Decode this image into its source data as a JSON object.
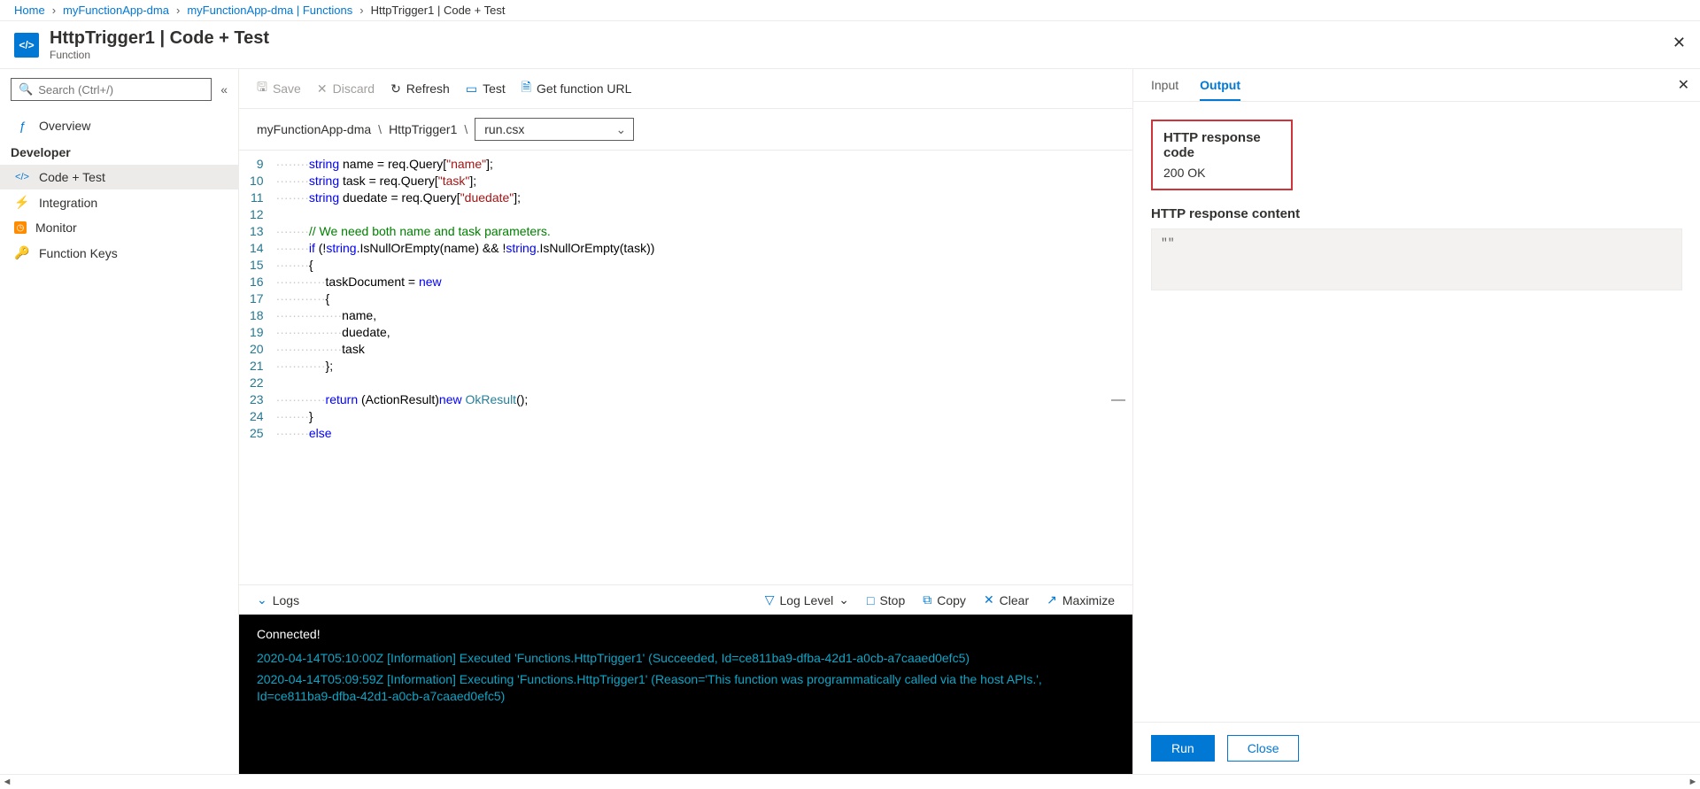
{
  "breadcrumb": [
    {
      "label": "Home",
      "link": true
    },
    {
      "label": "myFunctionApp-dma",
      "link": true
    },
    {
      "label": "myFunctionApp-dma | Functions",
      "link": true
    },
    {
      "label": "HttpTrigger1 | Code + Test",
      "link": false
    }
  ],
  "header": {
    "title": "HttpTrigger1 | Code + Test",
    "subtitle": "Function"
  },
  "sidebar": {
    "search_placeholder": "Search (Ctrl+/)",
    "overview": "Overview",
    "developer_header": "Developer",
    "items": [
      {
        "label": "Code + Test"
      },
      {
        "label": "Integration"
      },
      {
        "label": "Monitor"
      },
      {
        "label": "Function Keys"
      }
    ]
  },
  "toolbar": {
    "save": "Save",
    "discard": "Discard",
    "refresh": "Refresh",
    "test": "Test",
    "get_url": "Get function URL"
  },
  "pathbar": {
    "app": "myFunctionApp-dma",
    "fn": "HttpTrigger1",
    "file": "run.csx"
  },
  "code_lines": [
    {
      "n": 9,
      "html": "<span class='dots'>········</span><span class='kw'>string</span> name = req.Query[<span class='str'>\"name\"</span>];"
    },
    {
      "n": 10,
      "html": "<span class='dots'>········</span><span class='kw'>string</span> task = req.Query[<span class='str'>\"task\"</span>];"
    },
    {
      "n": 11,
      "html": "<span class='dots'>········</span><span class='kw'>string</span> duedate = req.Query[<span class='str'>\"duedate\"</span>];"
    },
    {
      "n": 12,
      "html": ""
    },
    {
      "n": 13,
      "html": "<span class='dots'>········</span><span class='cmt'>// We need both name and task parameters.</span>"
    },
    {
      "n": 14,
      "html": "<span class='dots'>········</span><span class='kw'>if</span> (!<span class='kw'>string</span>.IsNullOrEmpty(name) &amp;&amp; !<span class='kw'>string</span>.IsNullOrEmpty(task))"
    },
    {
      "n": 15,
      "html": "<span class='dots'>········</span>{"
    },
    {
      "n": 16,
      "html": "<span class='dots'>············</span>taskDocument = <span class='kw'>new</span>"
    },
    {
      "n": 17,
      "html": "<span class='dots'>············</span>{"
    },
    {
      "n": 18,
      "html": "<span class='dots'>················</span>name,"
    },
    {
      "n": 19,
      "html": "<span class='dots'>················</span>duedate,"
    },
    {
      "n": 20,
      "html": "<span class='dots'>················</span>task"
    },
    {
      "n": 21,
      "html": "<span class='dots'>············</span>};"
    },
    {
      "n": 22,
      "html": ""
    },
    {
      "n": 23,
      "html": "<span class='dots'>············</span><span class='kw'>return</span> (ActionResult)<span class='kw'>new</span> <span class='type'>OkResult</span>();"
    },
    {
      "n": 24,
      "html": "<span class='dots'>········</span>}"
    },
    {
      "n": 25,
      "html": "<span class='dots'>········</span><span class='kw'>else</span>"
    }
  ],
  "logsbar": {
    "logs": "Logs",
    "loglevel": "Log Level",
    "stop": "Stop",
    "copy": "Copy",
    "clear": "Clear",
    "maximize": "Maximize"
  },
  "console": {
    "connected": "Connected!",
    "lines": [
      "2020-04-14T05:10:00Z   [Information]   Executed 'Functions.HttpTrigger1' (Succeeded, Id=ce811ba9-dfba-42d1-a0cb-a7caaed0efc5)",
      "2020-04-14T05:09:59Z   [Information]   Executing 'Functions.HttpTrigger1' (Reason='This function was programmatically called via the host APIs.', Id=ce811ba9-dfba-42d1-a0cb-a7caaed0efc5)"
    ]
  },
  "rightpanel": {
    "tab_input": "Input",
    "tab_output": "Output",
    "resp_code_label": "HTTP response code",
    "resp_code_value": "200 OK",
    "resp_content_label": "HTTP response content",
    "resp_content_value": "\"\"",
    "run": "Run",
    "close": "Close"
  }
}
